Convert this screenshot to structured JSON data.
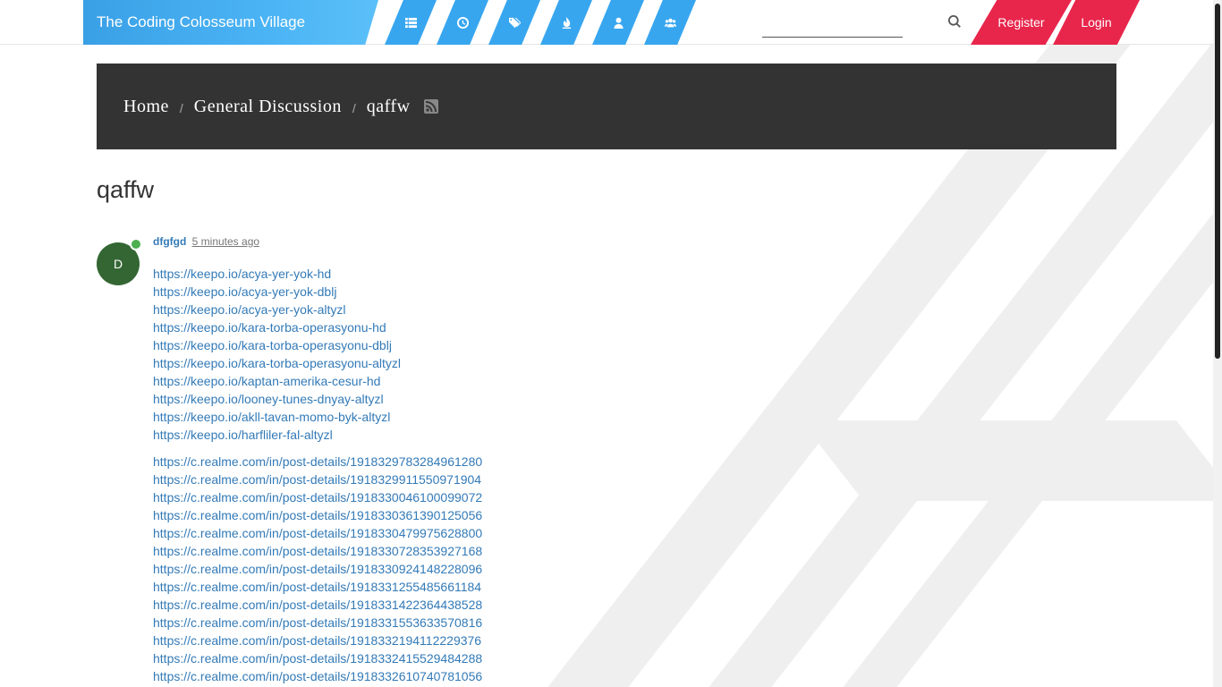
{
  "site": {
    "title": "The Coding Colosseum Village"
  },
  "nav": {
    "tabs": [
      {
        "name": "categories",
        "icon": "list-icon"
      },
      {
        "name": "recent",
        "icon": "clock-icon"
      },
      {
        "name": "tags",
        "icon": "tags-icon"
      },
      {
        "name": "popular",
        "icon": "fire-icon"
      },
      {
        "name": "users",
        "icon": "user-icon"
      },
      {
        "name": "groups",
        "icon": "group-icon"
      }
    ],
    "search_value": "",
    "register_label": "Register",
    "login_label": "Login",
    "accent_color": "#38a6ef",
    "auth_color": "#e8264c"
  },
  "breadcrumb": {
    "home": "Home",
    "category": "General Discussion",
    "topic": "qaffw"
  },
  "topic": {
    "title": "qaffw"
  },
  "post": {
    "avatar_letter": "D",
    "avatar_color": "#336633",
    "username": "dfgfgd",
    "time": "5 minutes ago",
    "links_group1": [
      "https://keepo.io/acya-yer-yok-hd",
      "https://keepo.io/acya-yer-yok-dblj",
      "https://keepo.io/acya-yer-yok-altyzl",
      "https://keepo.io/kara-torba-operasyonu-hd",
      "https://keepo.io/kara-torba-operasyonu-dblj",
      "https://keepo.io/kara-torba-operasyonu-altyzl",
      "https://keepo.io/kaptan-amerika-cesur-hd",
      "https://keepo.io/looney-tunes-dnyay-altyzl",
      "https://keepo.io/akll-tavan-momo-byk-altyzl",
      "https://keepo.io/harfliler-fal-altyzl"
    ],
    "links_group2": [
      "https://c.realme.com/in/post-details/1918329783284961280",
      "https://c.realme.com/in/post-details/1918329911550971904",
      "https://c.realme.com/in/post-details/1918330046100099072",
      "https://c.realme.com/in/post-details/1918330361390125056",
      "https://c.realme.com/in/post-details/1918330479975628800",
      "https://c.realme.com/in/post-details/1918330728353927168",
      "https://c.realme.com/in/post-details/1918330924148228096",
      "https://c.realme.com/in/post-details/1918331255485661184",
      "https://c.realme.com/in/post-details/1918331422364438528",
      "https://c.realme.com/in/post-details/1918331553633570816",
      "https://c.realme.com/in/post-details/1918332194112229376",
      "https://c.realme.com/in/post-details/1918332415529484288",
      "https://c.realme.com/in/post-details/1918332610740781056"
    ]
  }
}
